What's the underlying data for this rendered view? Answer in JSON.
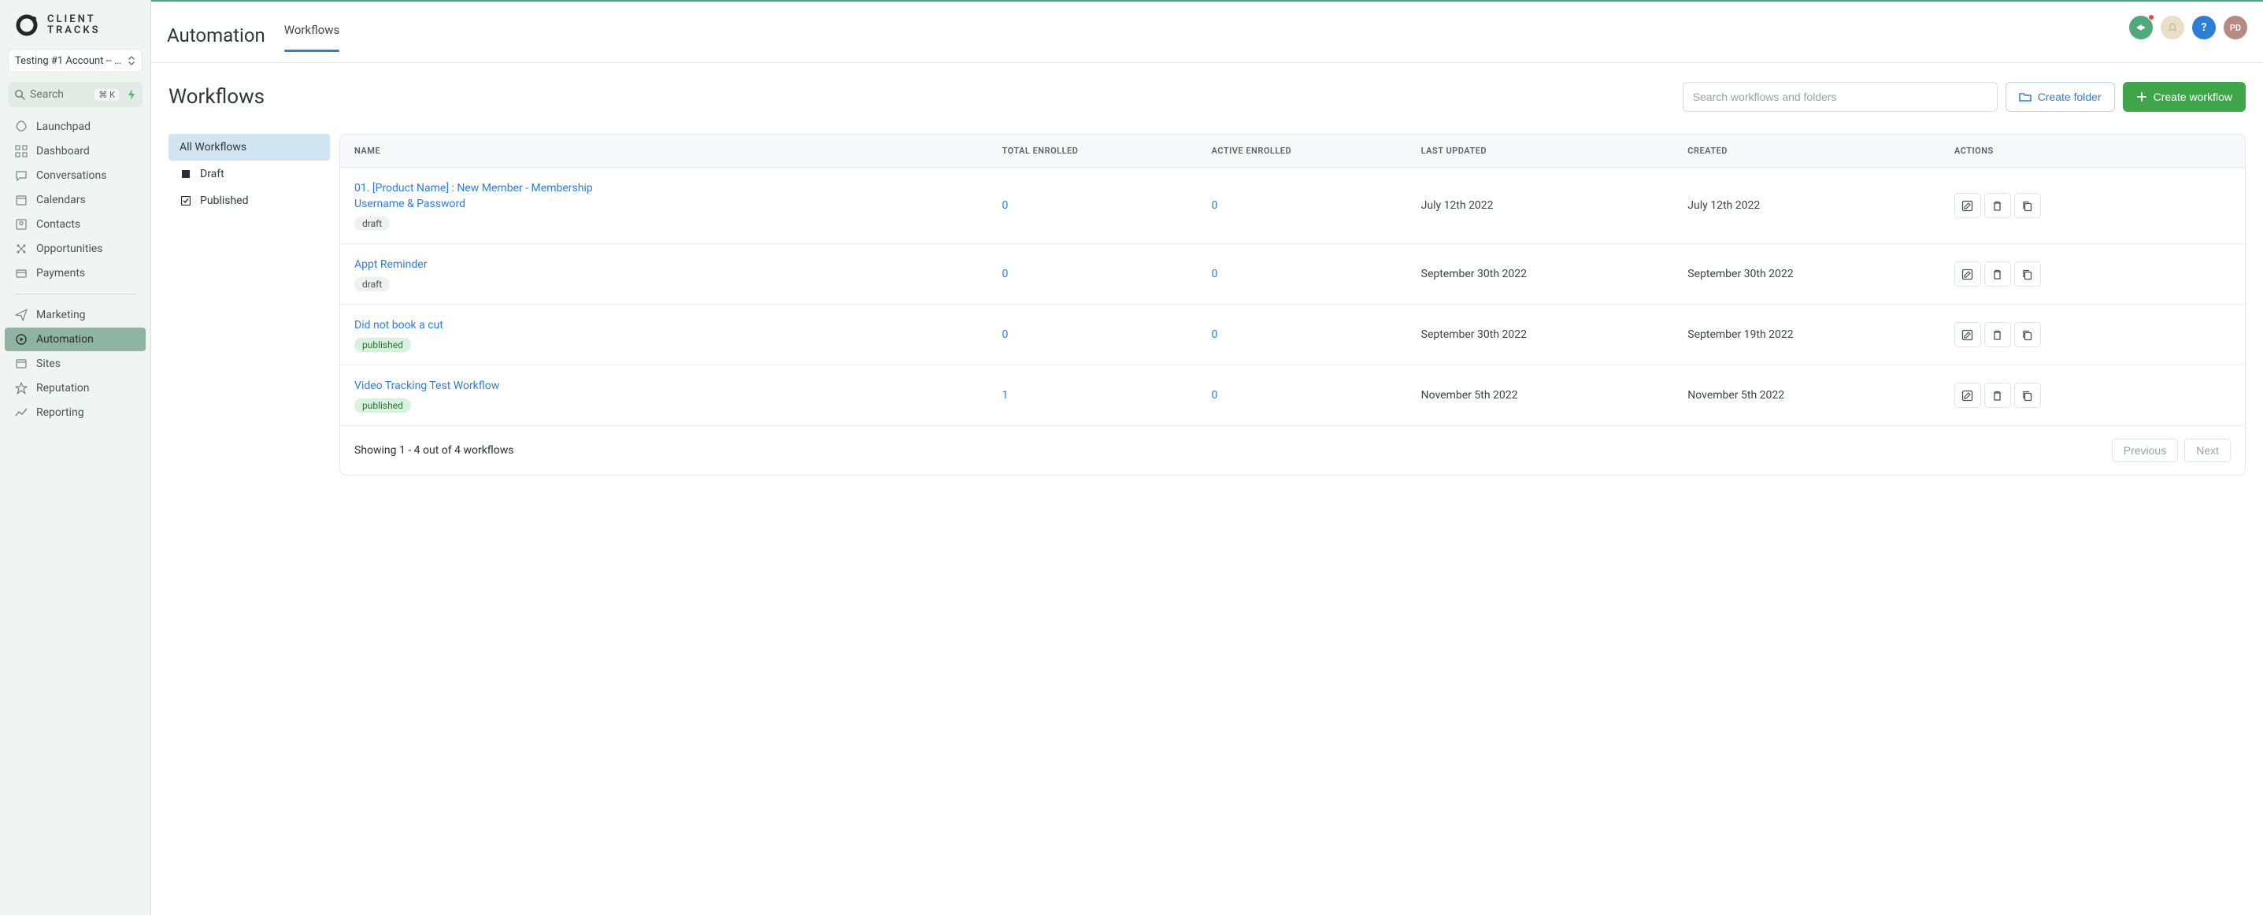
{
  "brand": {
    "line1": "CLIENT",
    "line2": "TRACKS"
  },
  "account": {
    "label": "Testing #1 Account -- …"
  },
  "search": {
    "placeholder": "Search",
    "shortcut": "⌘ K"
  },
  "nav": {
    "items": [
      {
        "label": "Launchpad",
        "active": false
      },
      {
        "label": "Dashboard",
        "active": false
      },
      {
        "label": "Conversations",
        "active": false
      },
      {
        "label": "Calendars",
        "active": false
      },
      {
        "label": "Contacts",
        "active": false
      },
      {
        "label": "Opportunities",
        "active": false
      },
      {
        "label": "Payments",
        "active": false
      }
    ],
    "items2": [
      {
        "label": "Marketing",
        "active": false
      },
      {
        "label": "Automation",
        "active": true
      },
      {
        "label": "Sites",
        "active": false
      },
      {
        "label": "Reputation",
        "active": false
      },
      {
        "label": "Reporting",
        "active": false
      }
    ]
  },
  "avatar": {
    "initials": "PD"
  },
  "header": {
    "section": "Automation",
    "subtab": "Workflows",
    "page_title": "Workflows",
    "search_placeholder": "Search workflows and folders",
    "create_folder": "Create folder",
    "create_workflow": "Create workflow"
  },
  "filters": {
    "all": "All Workflows",
    "draft": "Draft",
    "published": "Published"
  },
  "table": {
    "columns": {
      "name": "NAME",
      "total": "TOTAL ENROLLED",
      "active": "ACTIVE ENROLLED",
      "updated": "LAST UPDATED",
      "created": "CREATED",
      "actions": "ACTIONS"
    },
    "rows": [
      {
        "name": "01. [Product Name] : New Member - Membership Username & Password",
        "status": "draft",
        "total": "0",
        "active": "0",
        "updated": "July 12th 2022",
        "created": "July 12th 2022"
      },
      {
        "name": "Appt Reminder",
        "status": "draft",
        "total": "0",
        "active": "0",
        "updated": "September 30th 2022",
        "created": "September 30th 2022"
      },
      {
        "name": "Did not book a cut",
        "status": "published",
        "total": "0",
        "active": "0",
        "updated": "September 30th 2022",
        "created": "September 19th 2022"
      },
      {
        "name": "Video Tracking Test Workflow",
        "status": "published",
        "total": "1",
        "active": "0",
        "updated": "November 5th 2022",
        "created": "November 5th 2022"
      }
    ],
    "footer_text": "Showing 1 - 4 out of 4 workflows",
    "prev": "Previous",
    "next": "Next"
  }
}
